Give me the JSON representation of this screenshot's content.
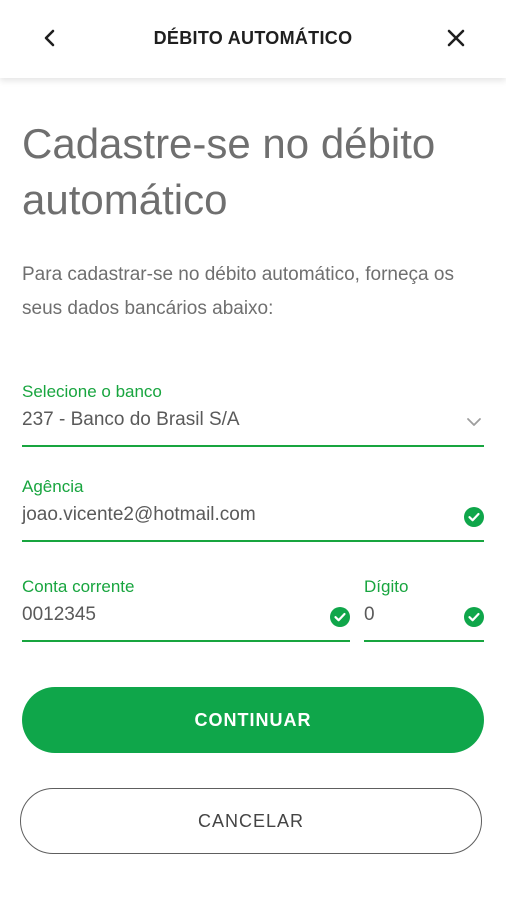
{
  "header": {
    "title": "DÉBITO AUTOMÁTICO",
    "back_icon": "chevron-left-icon",
    "close_icon": "close-icon"
  },
  "main": {
    "title": "Cadastre-se no débito automático",
    "intro": "Para cadastrar-se no débito automático, forneça os seus dados bancários abaixo:"
  },
  "form": {
    "bank": {
      "label": "Selecione o banco",
      "value": "237 - Banco do Brasil S/A",
      "icon": "chevron-down-icon"
    },
    "agency": {
      "label": "Agência",
      "value": "joao.vicente2@hotmail.com",
      "icon": "check-circle-icon"
    },
    "account": {
      "label": "Conta corrente",
      "value": "0012345",
      "icon": "check-circle-icon"
    },
    "digit": {
      "label": "Dígito",
      "value": "0",
      "icon": "check-circle-icon"
    }
  },
  "actions": {
    "continue_label": "CONTINUAR",
    "cancel_label": "CANCELAR"
  },
  "colors": {
    "accent": "#0fa64a",
    "text": "#6f6f6f"
  }
}
